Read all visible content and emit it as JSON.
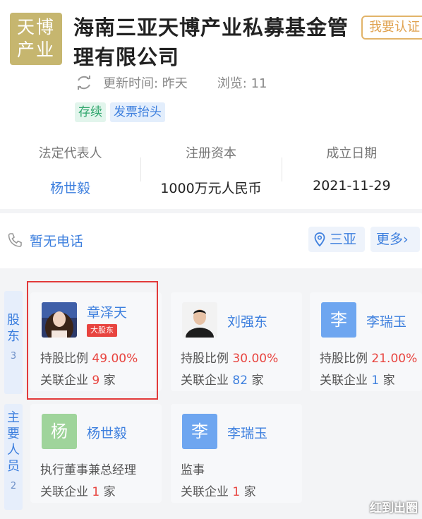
{
  "company": {
    "logo_text": "天博产业",
    "name": "海南三亚天博产业私募基金管理有限公司",
    "claim_button": "我要认证",
    "updated": "更新时间: 昨天",
    "views": "浏览: 11",
    "tags": [
      "存续",
      "发票抬头"
    ]
  },
  "info": [
    {
      "label": "法定代表人",
      "value": "杨世毅"
    },
    {
      "label": "注册资本",
      "value": "1000万元人民币"
    },
    {
      "label": "成立日期",
      "value": "2021-11-29"
    }
  ],
  "contact": {
    "phone": "暂无电话",
    "location": "三亚",
    "more": "更多"
  },
  "shareholders": {
    "tab_label": "股东",
    "tab_count": "3",
    "cards": [
      {
        "name": "章泽天",
        "badge": "大股东",
        "ratio_label": "持股比例",
        "ratio": "49.00%",
        "related_label": "关联企业",
        "related_count": "9",
        "related_unit": "家"
      },
      {
        "name": "刘强东",
        "ratio_label": "持股比例",
        "ratio": "30.00%",
        "related_label": "关联企业",
        "related_count": "82",
        "related_unit": "家"
      },
      {
        "name": "李瑞玉",
        "avatar_letter": "李",
        "ratio_label": "持股比例",
        "ratio": "21.00%",
        "related_label": "关联企业",
        "related_count": "1",
        "related_unit": "家"
      }
    ]
  },
  "staff": {
    "tab_label": "主要人员",
    "tab_count": "2",
    "cards": [
      {
        "name": "杨世毅",
        "avatar_letter": "杨",
        "role": "执行董事兼总经理",
        "related_label": "关联企业",
        "related_count": "1",
        "related_unit": "家"
      },
      {
        "name": "李瑞玉",
        "avatar_letter": "李",
        "role": "监事",
        "related_label": "关联企业",
        "related_count": "1",
        "related_unit": "家"
      }
    ]
  },
  "watermark": "红到出圈",
  "colors": {
    "accent": "#3d7fde",
    "highlight": "#e8443f",
    "logo_bg": "#c6b66f",
    "status_green": "#2fa66c"
  }
}
